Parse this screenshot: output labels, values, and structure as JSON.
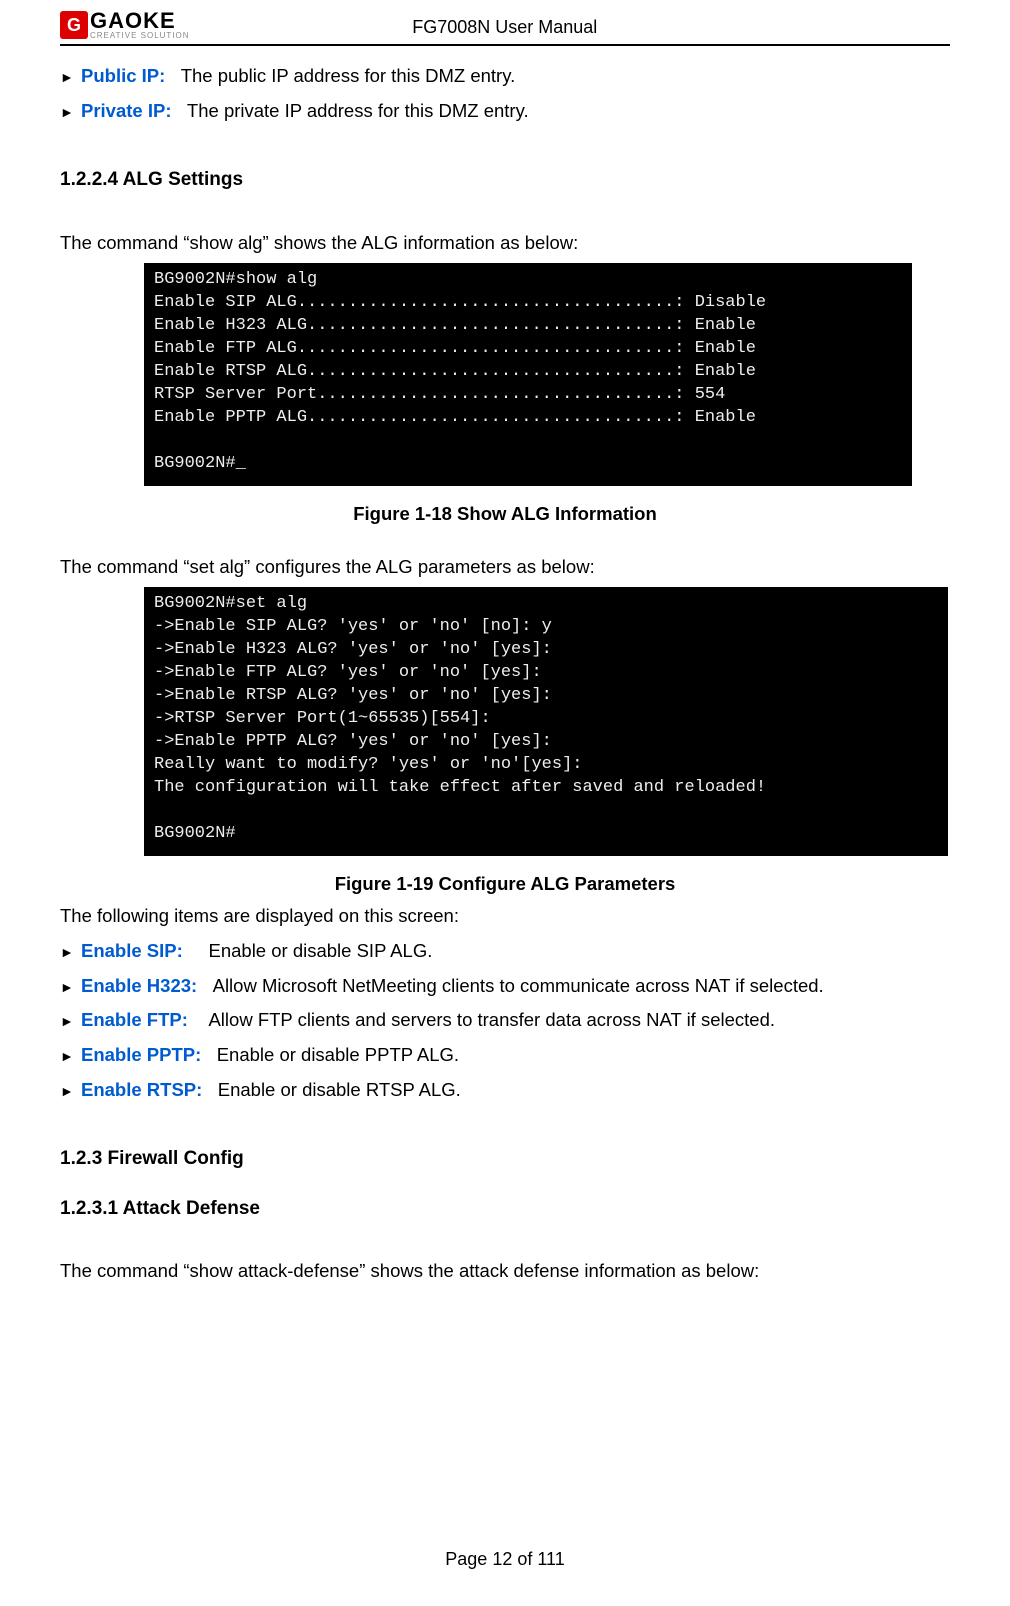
{
  "header": {
    "logo_name": "GAOKE",
    "logo_sub": "CREATIVE SOLUTION",
    "title": "FG7008N User Manual"
  },
  "defs_top": [
    {
      "term": "Public IP:",
      "desc": "The public IP address for this DMZ entry."
    },
    {
      "term": "Private IP:",
      "desc": "The private IP address for this DMZ entry."
    }
  ],
  "section_1224": "1.2.2.4    ALG Settings",
  "para_show_alg": "The command “show alg” shows the ALG information as below:",
  "terminal_show_alg": "BG9002N#show alg\nEnable SIP ALG.....................................: Disable\nEnable H323 ALG....................................: Enable\nEnable FTP ALG.....................................: Enable\nEnable RTSP ALG....................................: Enable\nRTSP Server Port...................................: 554\nEnable PPTP ALG....................................: Enable\n\nBG9002N#_",
  "fig18": "Figure 1-18    Show ALG Information",
  "para_set_alg": "The command “set alg” configures the ALG parameters as below:",
  "terminal_set_alg": "BG9002N#set alg\n->Enable SIP ALG? 'yes' or 'no' [no]: y\n->Enable H323 ALG? 'yes' or 'no' [yes]:\n->Enable FTP ALG? 'yes' or 'no' [yes]:\n->Enable RTSP ALG? 'yes' or 'no' [yes]:\n->RTSP Server Port(1~65535)[554]:\n->Enable PPTP ALG? 'yes' or 'no' [yes]:\nReally want to modify? 'yes' or 'no'[yes]:\nThe configuration will take effect after saved and reloaded!\n\nBG9002N#",
  "fig19": "Figure 1-19    Configure ALG Parameters",
  "para_items": "The following items are displayed on this screen:",
  "defs_alg": [
    {
      "term": "Enable SIP:",
      "desc": "Enable or disable SIP ALG."
    },
    {
      "term": "Enable H323:",
      "desc": "Allow Microsoft NetMeeting clients to communicate across NAT if selected."
    },
    {
      "term": "Enable FTP:",
      "desc": "Allow FTP clients and servers to transfer data across NAT if selected."
    },
    {
      "term": "Enable PPTP:",
      "desc": "Enable or disable PPTP ALG."
    },
    {
      "term": "Enable RTSP:",
      "desc": "Enable or disable RTSP ALG."
    }
  ],
  "section_123": "1.2.3     Firewall Config",
  "section_1231": "1.2.3.1    Attack Defense",
  "para_attack": "The command “show attack-defense” shows the attack defense information as below:",
  "footer": "Page 12 of 111"
}
